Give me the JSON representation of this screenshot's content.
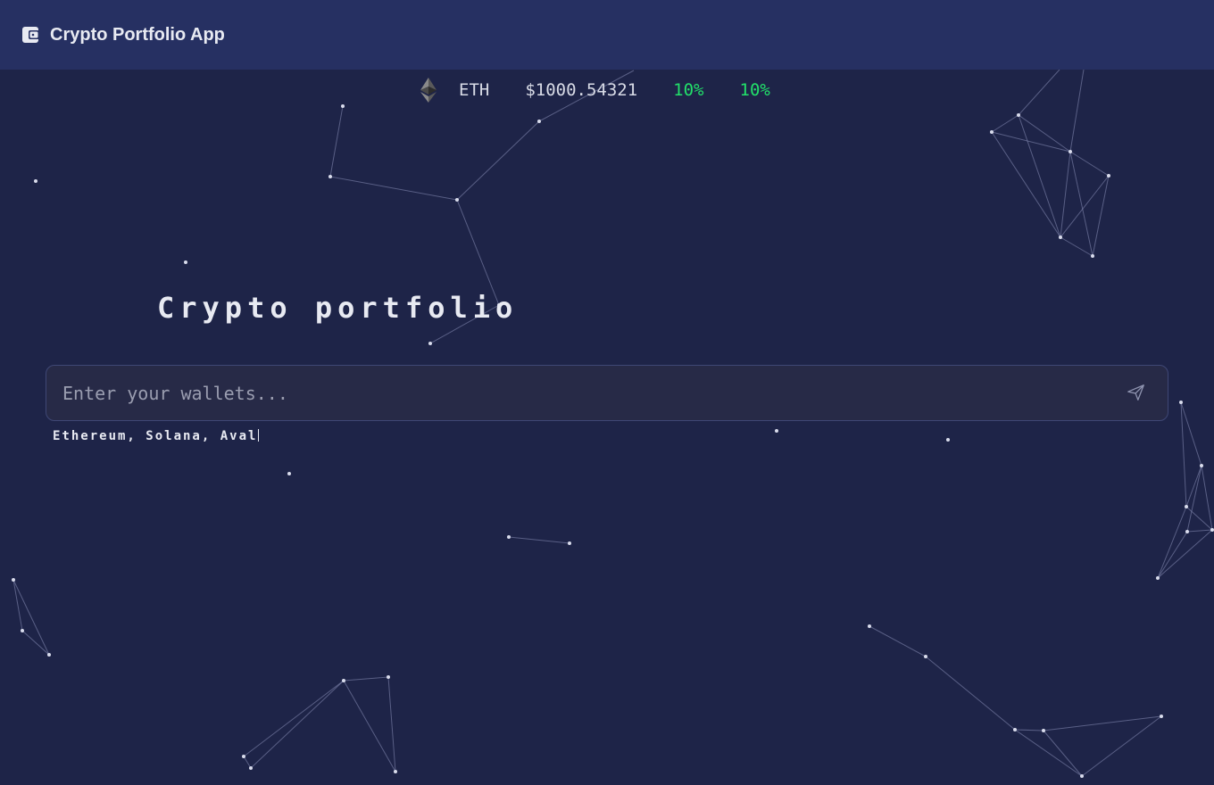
{
  "header": {
    "title": "Crypto Portfolio App",
    "icon": "wallet-icon"
  },
  "ticker": {
    "icon": "ethereum-icon",
    "symbol": "ETH",
    "price": "$1000.54321",
    "change_1": "10%",
    "change_2": "10%",
    "positive_color": "#22e06a"
  },
  "main": {
    "heading": "Crypto portfolio",
    "wallet_input": {
      "placeholder": "Enter your wallets...",
      "value": ""
    },
    "send_icon": "send-icon",
    "chains_text": "Ethereum, Solana, Aval"
  },
  "colors": {
    "background": "#1e2448",
    "header": "#263062",
    "input_bg": "#272a47",
    "input_border": "#3f4775"
  }
}
